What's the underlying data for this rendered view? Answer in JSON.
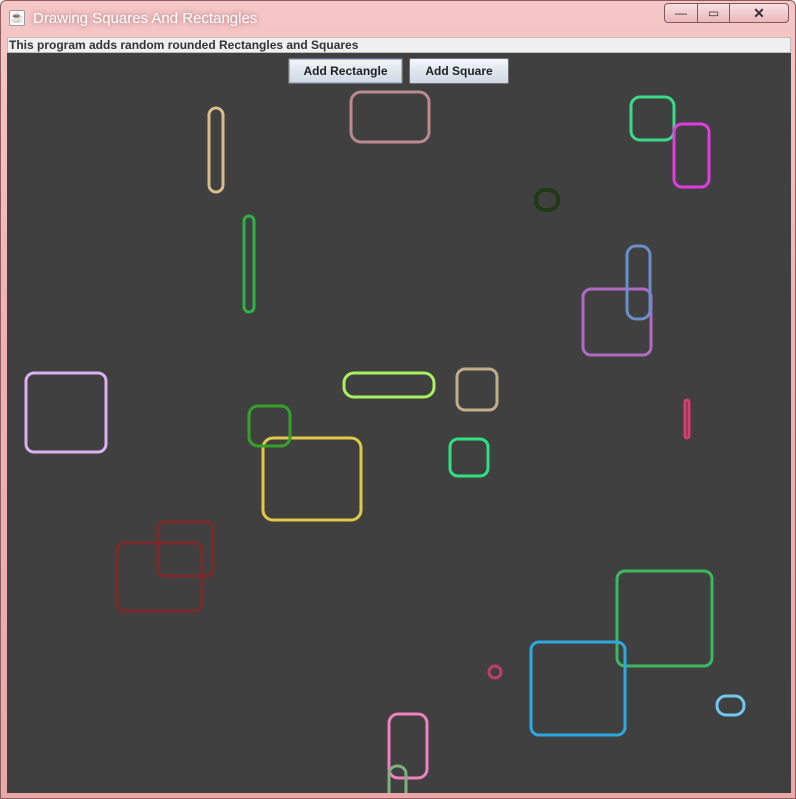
{
  "window": {
    "title": "Drawing Squares And Rectangles",
    "icon": "java-cup-icon"
  },
  "window_controls": {
    "minimize_icon": "minimize-icon",
    "maximize_icon": "maximize-icon",
    "close_icon": "close-icon",
    "minimize_glyph": "—",
    "maximize_glyph": "▭",
    "close_glyph": "✕"
  },
  "info_label": "This program adds random rounded Rectangles and Squares",
  "buttons": {
    "add_rectangle": "Add Rectangle",
    "add_square": "Add Square"
  },
  "canvas": {
    "background": "#404040",
    "shape_colors": [
      "#d8bc8c",
      "#b98a8e",
      "#3cd98a",
      "#e03ce0",
      "#1f3a18",
      "#2eb04a",
      "#6b8ec8",
      "#b06ac0",
      "#dcb0f0",
      "#a8f060",
      "#c0ae88",
      "#d83c70",
      "#38a02a",
      "#e0c848",
      "#30e080",
      "#7a2a2a",
      "#3cb860",
      "#2ea8e0",
      "#c03c70",
      "#70c8f0",
      "#f080c0",
      "#80b080"
    ]
  }
}
